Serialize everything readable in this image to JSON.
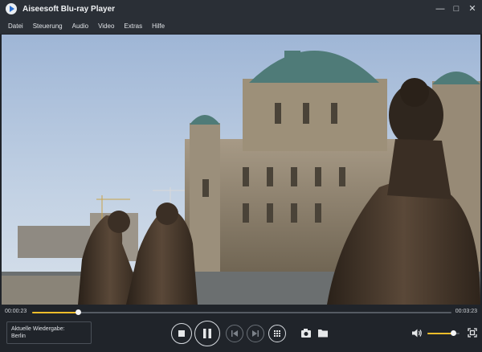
{
  "window": {
    "title": "Aiseesoft Blu-ray Player",
    "minimize_glyph": "—",
    "maximize_glyph": "□",
    "close_glyph": "✕"
  },
  "menu": {
    "items": [
      "Datei",
      "Steuerung",
      "Audio",
      "Video",
      "Extras",
      "Hilfe"
    ]
  },
  "playback": {
    "current_time": "00:00:23",
    "total_time": "00:03:23",
    "progress": 0.11,
    "volume": 0.8
  },
  "now_playing": {
    "label": "Aktuelle Wiedergabe:",
    "title": "Berlin"
  },
  "icons": {
    "stop": "stop-icon",
    "pause": "pause-icon",
    "previous": "previous-chapter-icon",
    "next": "next-chapter-icon",
    "menu": "disc-menu-icon",
    "snapshot": "camera-icon",
    "open": "folder-icon",
    "volume": "speaker-icon",
    "fullscreen": "fullscreen-icon"
  },
  "colors": {
    "accent": "#f1bd2b",
    "background": "#20242a",
    "titlebar": "#2a2f36"
  }
}
